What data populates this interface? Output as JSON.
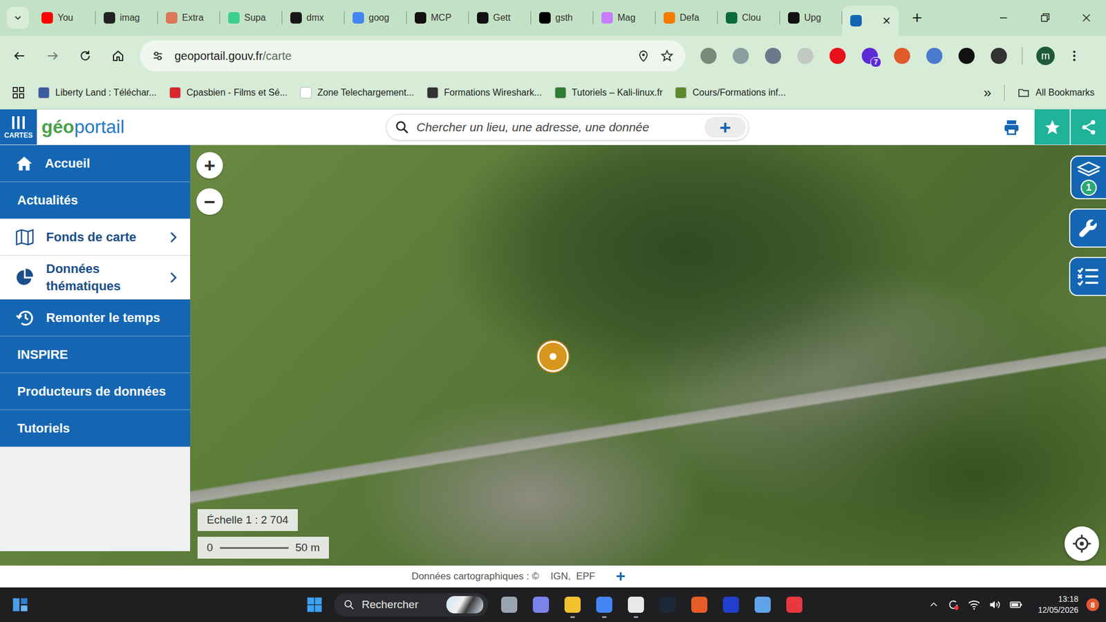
{
  "browser": {
    "tabs": [
      {
        "label": "You",
        "selected": false,
        "color": "#ff0000"
      },
      {
        "label": "imag",
        "selected": false,
        "color": "#222222"
      },
      {
        "label": "Extra",
        "selected": false,
        "color": "#d97757"
      },
      {
        "label": "Supa",
        "selected": false,
        "color": "#3ecf8e"
      },
      {
        "label": "dmx",
        "selected": false,
        "color": "#181717"
      },
      {
        "label": "goog",
        "selected": false,
        "color": "#4285f4"
      },
      {
        "label": "MCP",
        "selected": false,
        "color": "#111111"
      },
      {
        "label": "Gett",
        "selected": false,
        "color": "#111111"
      },
      {
        "label": "gsth",
        "selected": false,
        "color": "#000000"
      },
      {
        "label": "Mag",
        "selected": false,
        "color": "#c77dff"
      },
      {
        "label": "Defa",
        "selected": false,
        "color": "#f57c00"
      },
      {
        "label": "Clou",
        "selected": false,
        "color": "#0a6b3d"
      },
      {
        "label": "Upg",
        "selected": false,
        "color": "#111111"
      },
      {
        "label": "",
        "selected": true,
        "color": "#1466b3"
      }
    ],
    "close_glyph": "×",
    "new_tab_glyph": "+",
    "address": {
      "host": "geoportail.gouv.fr",
      "path": "/carte"
    },
    "extension_badge": "7",
    "profile_initial": "m",
    "bookmarks": [
      "Liberty Land : Téléchar...",
      "Cpasbien - Films et Sé...",
      "Zone Telechargement...",
      "Formations Wireshark...",
      "Tutoriels – Kali-linux.fr",
      "Cours/Formations inf..."
    ],
    "bookmarks_more": "»",
    "all_bookmarks": "All Bookmarks"
  },
  "app": {
    "menu_label": "CARTES",
    "logo": {
      "prefix": "géo",
      "suffix": "portail"
    },
    "search": {
      "placeholder": "Chercher un lieu, une adresse, une donnée",
      "add": "+"
    },
    "sidebar": [
      {
        "label": "Accueil",
        "kind": "link"
      },
      {
        "label": "Actualités",
        "kind": "link"
      },
      {
        "label": "Fonds de carte",
        "kind": "submenu"
      },
      {
        "label": "Données thématiques",
        "kind": "submenu"
      },
      {
        "label": "Remonter le temps",
        "kind": "link"
      },
      {
        "label": "INSPIRE",
        "kind": "link"
      },
      {
        "label": "Producteurs de données",
        "kind": "link"
      },
      {
        "label": "Tutoriels",
        "kind": "link"
      }
    ],
    "map": {
      "zoom_in": "+",
      "zoom_out": "−",
      "layers_count": "1",
      "scale": "Échelle 1 : 2 704",
      "scale_start": "0",
      "scale_end": "50 m"
    },
    "attribution": {
      "label": "Données cartographiques : ©",
      "sources": "IGN,  EPF",
      "more": "+"
    }
  },
  "taskbar": {
    "search": "Rechercher",
    "time": "13:18",
    "date": "12/05/2026",
    "notifications": "8"
  }
}
